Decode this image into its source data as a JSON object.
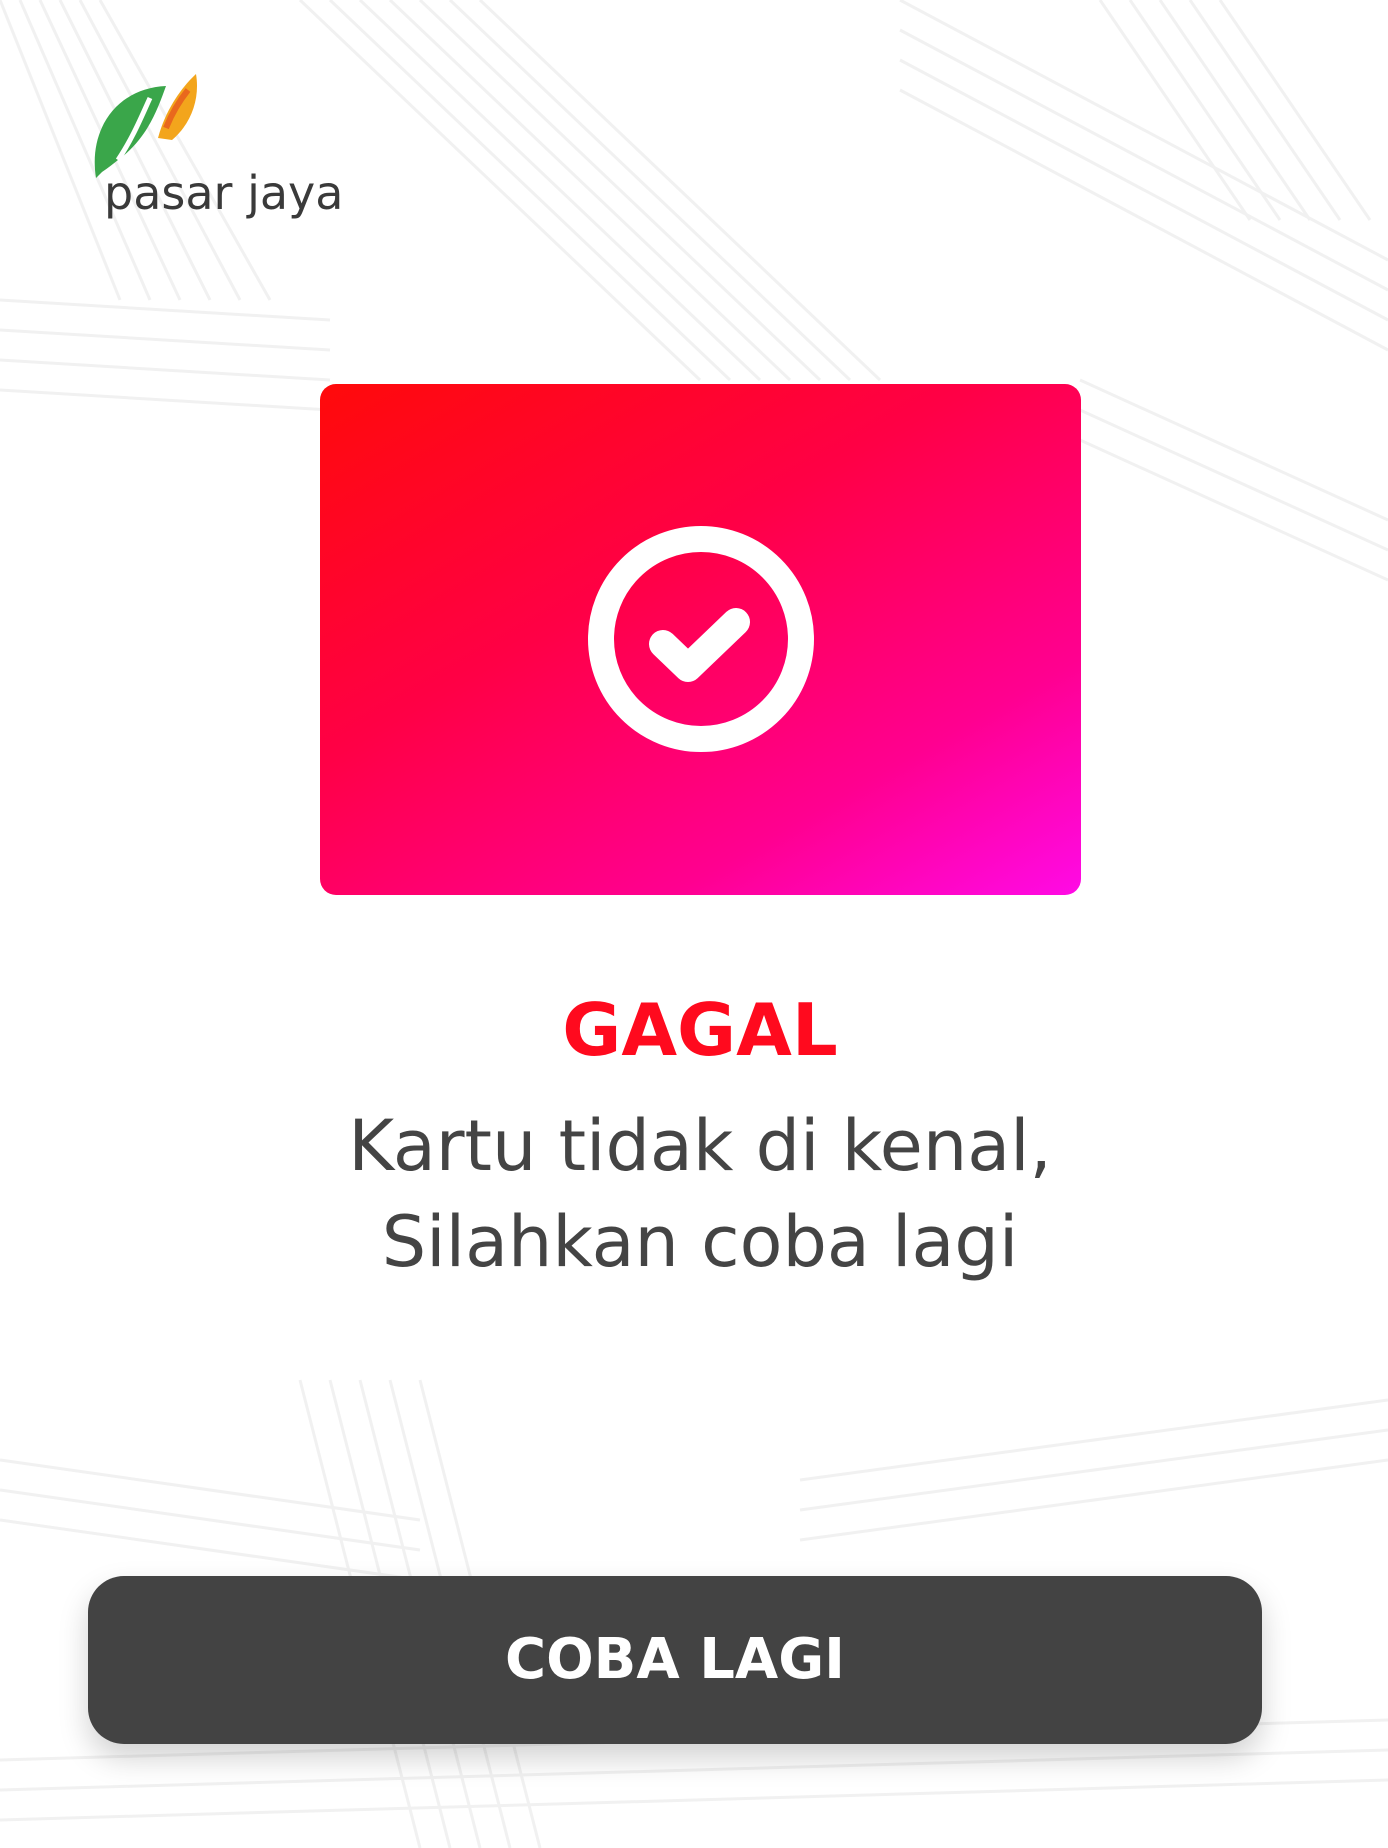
{
  "brand": {
    "logo_text": "pasar jaya",
    "logo_icon": "leaf-logo-icon"
  },
  "status_card": {
    "icon": "check-circle-icon",
    "gradient_colors": [
      "#ff0a0a",
      "#ff0046",
      "#ff0090",
      "#ff0ae6"
    ]
  },
  "result": {
    "title": "GAGAL",
    "message_line1": "Kartu tidak di kenal,",
    "message_line2": "Silahkan coba lagi"
  },
  "actions": {
    "retry_label": "COBA LAGI"
  },
  "colors": {
    "title": "#ff0a1e",
    "message": "#444444",
    "button_bg": "#434343",
    "button_text": "#ffffff"
  }
}
